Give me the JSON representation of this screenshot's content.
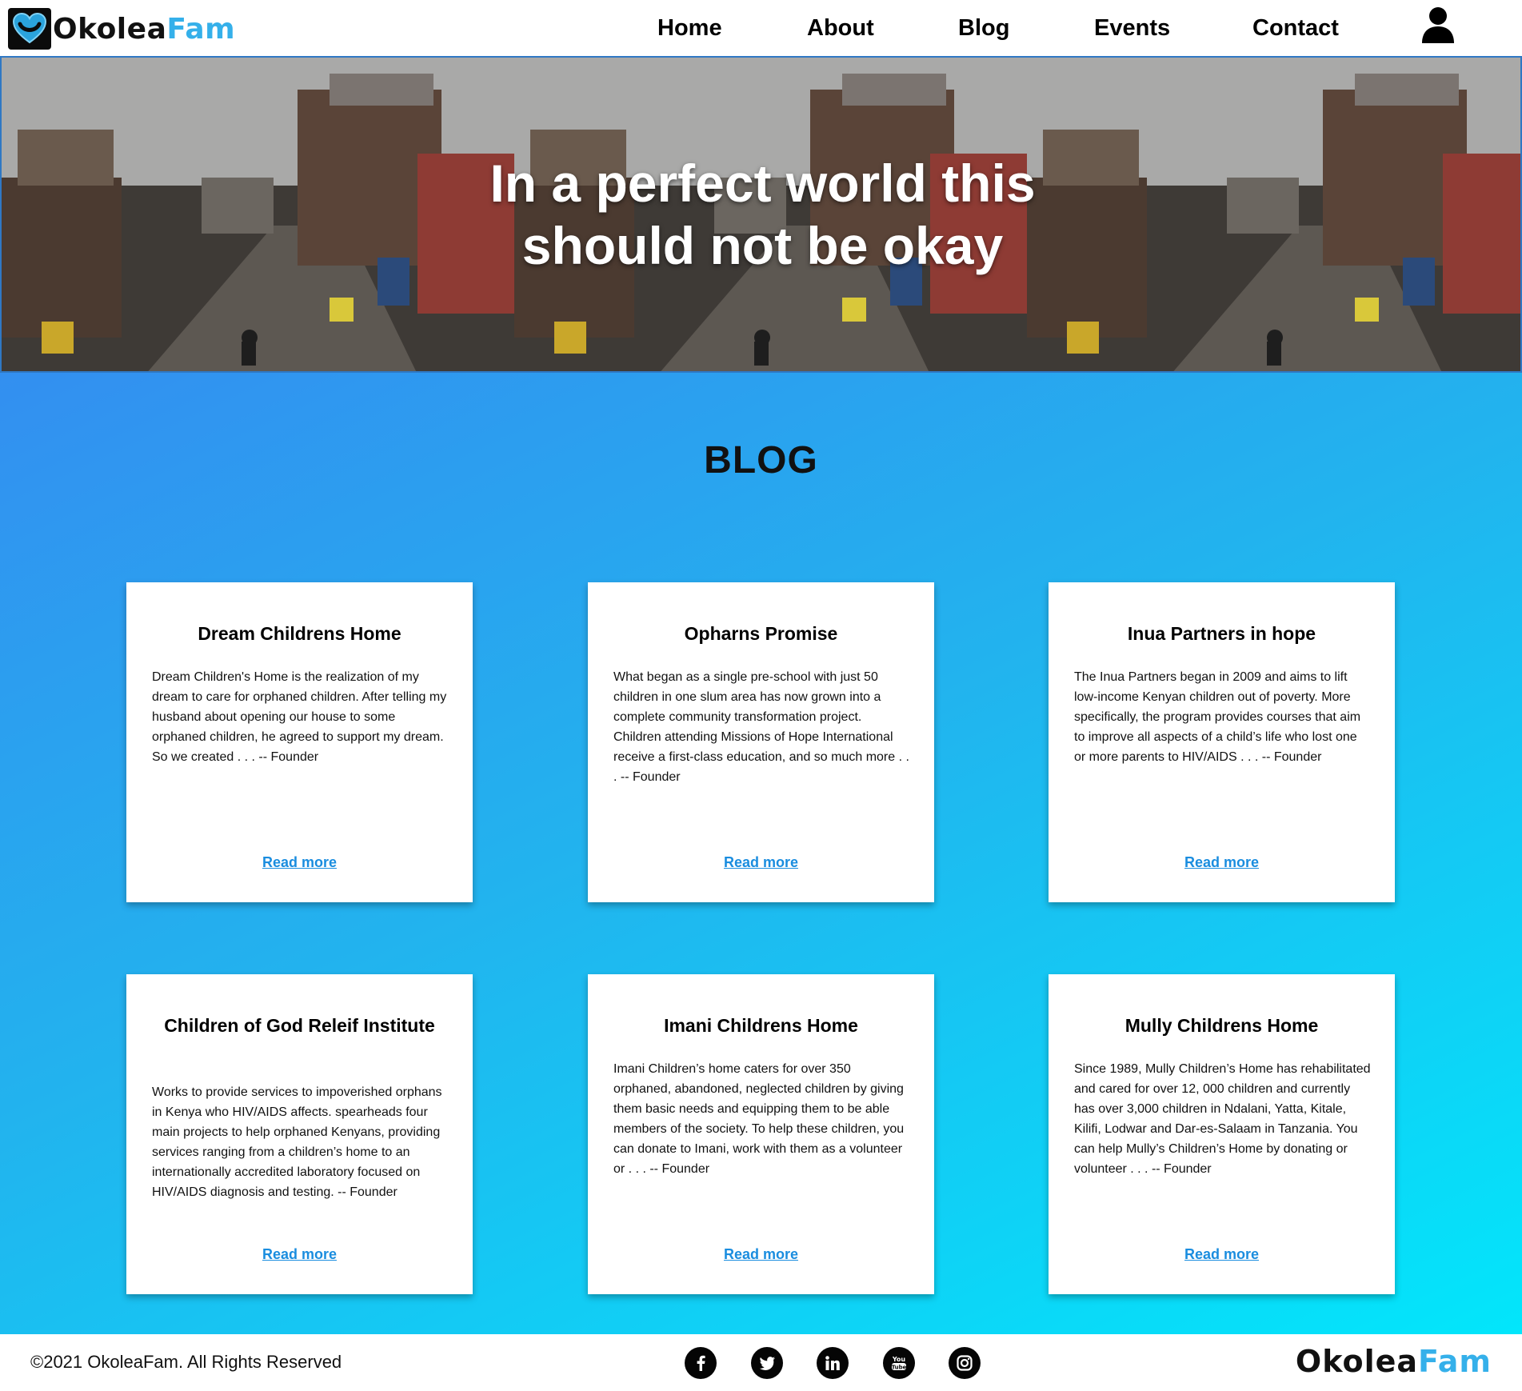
{
  "brand": {
    "name_part1": "Okolea",
    "name_part2": "Fam",
    "accent_color": "#35b0ea"
  },
  "nav": {
    "items": [
      {
        "label": "Home"
      },
      {
        "label": "About"
      },
      {
        "label": "Blog"
      },
      {
        "label": "Events"
      },
      {
        "label": "Contact"
      }
    ],
    "user_icon": "user-icon"
  },
  "hero": {
    "title_line1": "In a perfect world this",
    "title_line2": "should not be okay",
    "border_color": "#2f78c4"
  },
  "blog": {
    "title": "BLOG",
    "gradient": [
      "#338ff0",
      "#02e6fb"
    ],
    "cards": [
      {
        "title": "Dream Childrens Home",
        "body": "Dream Children's Home is the realization of my dream to care for orphaned children. After telling my husband about opening our house to some orphaned children, he agreed to support my dream. So we created . . . -- Founder",
        "link": "Read more"
      },
      {
        "title": "Opharns Promise",
        "body": "What began as a single pre-school with just 50 children in one slum area has now grown into a complete community transformation project. Children attending Missions of Hope International receive a first-class education, and so much more . . . -- Founder",
        "link": "Read more"
      },
      {
        "title": "Inua Partners in hope",
        "body": "The Inua Partners began in 2009 and aims to lift low-income Kenyan children out of poverty. More specifically, the program provides courses that aim to improve all aspects of a child’s life who lost one or more parents to HIV/AIDS . . . -- Founder",
        "link": "Read more"
      },
      {
        "title": "Children of God Releif Institute",
        "body": "Works to provide services to impoverished orphans in Kenya who HIV/AIDS affects. spearheads four main projects to help orphaned Kenyans, providing services ranging from a children’s home to an internationally accredited laboratory focused on HIV/AIDS diagnosis and testing. -- Founder",
        "link": "Read more"
      },
      {
        "title": "Imani Childrens Home",
        "body": "Imani Children’s home caters for over 350 orphaned, abandoned, neglected children by giving them basic needs and equipping them to be able members of the society. To help these children, you can donate to Imani, work with them as a volunteer or . . . -- Founder",
        "link": "Read more"
      },
      {
        "title": "Mully Childrens Home",
        "body": "Since 1989, Mully Children’s Home has rehabilitated and cared for over 12, 000 children and currently has over 3,000 children in Ndalani, Yatta, Kitale, Kilifi, Lodwar and Dar-es-Salaam in Tanzania. You can help Mully’s Children’s Home by donating or volunteer . . . -- Founder",
        "link": "Read more"
      }
    ]
  },
  "footer": {
    "copyright": "©2021 OkoleaFam. All Rights Reserved",
    "social": [
      {
        "icon": "facebook-icon",
        "glyph": "f"
      },
      {
        "icon": "twitter-icon",
        "glyph": "t"
      },
      {
        "icon": "linkedin-icon",
        "glyph": "in"
      },
      {
        "icon": "youtube-icon",
        "glyph": "You Tube"
      },
      {
        "icon": "instagram-icon",
        "glyph": ""
      }
    ]
  }
}
